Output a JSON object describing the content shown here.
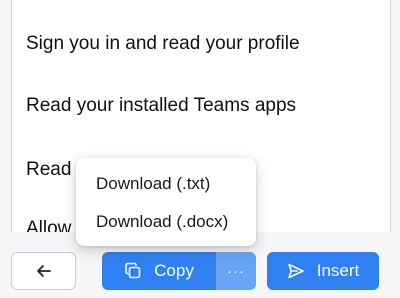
{
  "permissions": [
    "Sign you in and read your profile",
    "Read your installed Teams apps",
    "Read",
    "Allow"
  ],
  "dropdown": {
    "items": [
      "Download (.txt)",
      "Download (.docx)"
    ]
  },
  "footer": {
    "back_icon": "arrow-left-icon",
    "copy_label": "Copy",
    "copy_icon": "copy-icon",
    "more_label": "···",
    "insert_label": "Insert",
    "insert_icon": "send-icon"
  },
  "colors": {
    "primary": "#2f80f0",
    "primary_light": "#69a4f4"
  }
}
